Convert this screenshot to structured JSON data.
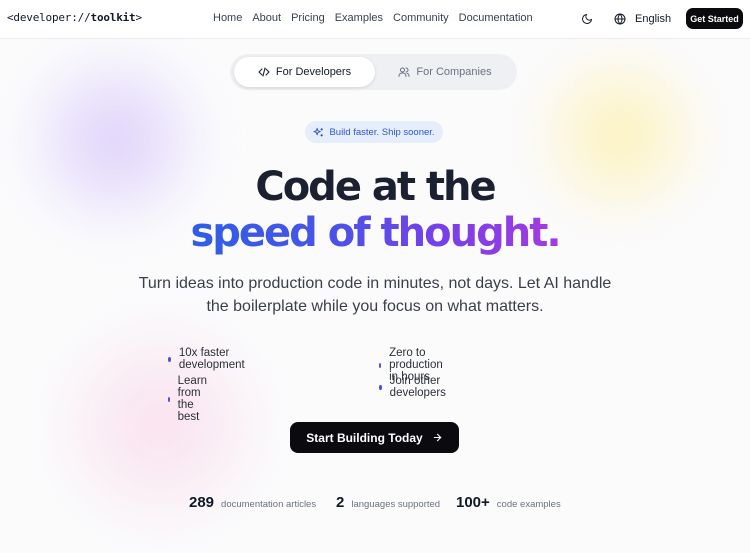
{
  "nav": {
    "logo_prefix": "<developer:",
    "logo_sep": "//",
    "logo_name": "toolkit",
    "logo_suffix": ">",
    "links": [
      "Home",
      "About",
      "Pricing",
      "Examples",
      "Community",
      "Documentation"
    ],
    "language": "English",
    "cta": "Get Started",
    "icons": {
      "theme": "moon-icon",
      "language": "globe-icon"
    }
  },
  "toggle": {
    "developers": "For Developers",
    "companies": "For Companies",
    "selected": "For Developers",
    "icons": {
      "developers": "code-icon",
      "companies": "users-icon"
    }
  },
  "badge": {
    "label": "Build faster. Ship sooner.",
    "icon": "sparkles-icon"
  },
  "hero": {
    "headline_line1": "Code at the",
    "headline_line2": "speed of thought.",
    "subtitle_line1": "Turn ideas into production code in minutes, not days. Let AI handle",
    "subtitle_line2": "the boilerplate while you focus on what matters."
  },
  "features": [
    "10x faster development",
    "Zero to production in hours",
    "Learn from the best",
    "Join other developers"
  ],
  "cta": {
    "label": "Start Building Today",
    "icon": "arrow-right-icon"
  },
  "stats": [
    {
      "value": "289",
      "label": "documentation articles"
    },
    {
      "value": "2",
      "label": "languages supported"
    },
    {
      "value": "100+",
      "label": "code examples"
    }
  ],
  "colors": {
    "accent_start": "#2f5ee6",
    "accent_end": "#a43be0",
    "dark_button": "#0b0b0f",
    "badge_bg": "#e6edfb",
    "badge_text": "#2f56c8"
  }
}
